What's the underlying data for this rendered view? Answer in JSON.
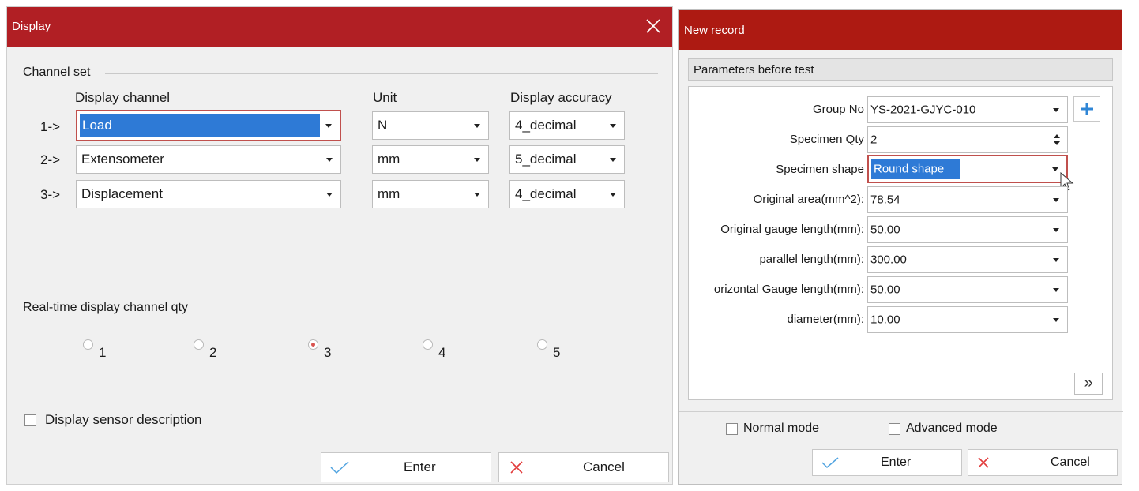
{
  "display_dialog": {
    "title": "Display",
    "channel_set_label": "Channel set",
    "headers": {
      "channel": "Display channel",
      "unit": "Unit",
      "accuracy": "Display accuracy"
    },
    "rows": [
      {
        "index": "1->",
        "channel": "Load",
        "unit": "N",
        "accuracy": "4_decimal"
      },
      {
        "index": "2->",
        "channel": "Extensometer",
        "unit": "mm",
        "accuracy": "5_decimal"
      },
      {
        "index": "3->",
        "channel": "Displacement",
        "unit": "mm",
        "accuracy": "4_decimal"
      }
    ],
    "realtime_label": "Real-time display channel qty",
    "radio_options": [
      "1",
      "2",
      "3",
      "4",
      "5"
    ],
    "radio_selected": "3",
    "sensor_description_label": "Display sensor description",
    "enter_label": "Enter",
    "cancel_label": "Cancel"
  },
  "new_record_dialog": {
    "title": "New record",
    "section_title": "Parameters before test",
    "fields": [
      {
        "label": "Group No",
        "value": "YS-2021-GJYC-010"
      },
      {
        "label": "Specimen Qty",
        "value": "2"
      },
      {
        "label": "Specimen shape",
        "value": "Round shape"
      },
      {
        "label": "Original area(mm^2):",
        "value": "78.54"
      },
      {
        "label": "Original gauge length(mm):",
        "value": "50.00"
      },
      {
        "label": "parallel length(mm):",
        "value": "300.00"
      },
      {
        "label": "orizontal Gauge length(mm):",
        "value": "50.00"
      },
      {
        "label": "diameter(mm):",
        "value": "10.00"
      }
    ],
    "expand_label": "»",
    "normal_mode_label": "Normal mode",
    "advanced_mode_label": "Advanced mode",
    "enter_label": "Enter",
    "cancel_label": "Cancel"
  },
  "colors": {
    "title_left": "#b11f24",
    "title_right": "#ad1a12",
    "check": "#4fa3e0",
    "cross": "#e23b3b",
    "selection": "#2e7ad6",
    "focus_border": "#c0504d"
  }
}
